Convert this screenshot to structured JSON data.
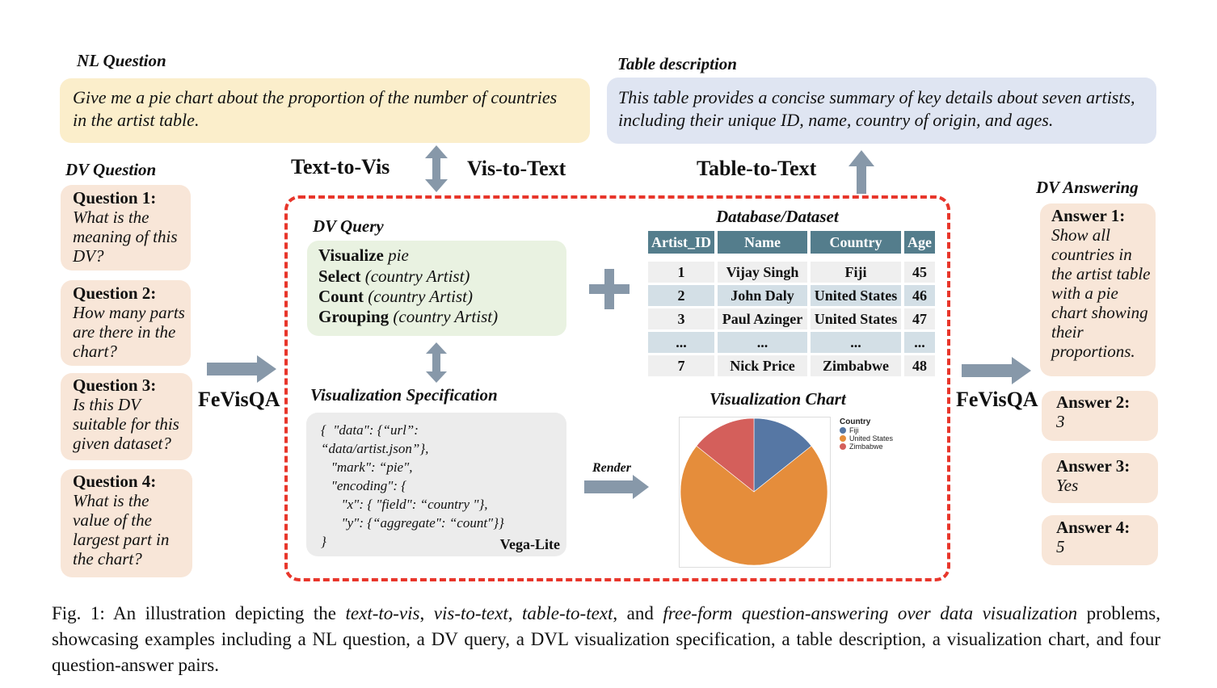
{
  "nl_question": {
    "title": "NL Question",
    "text": "Give me a pie chart about the proportion of the number of countries in the artist table."
  },
  "table_description": {
    "title": "Table description",
    "text": "This table provides a concise summary of key details about seven artists, including their unique ID, name, country of origin, and ages."
  },
  "labels": {
    "text_to_vis": "Text-to-Vis",
    "vis_to_text": "Vis-to-Text",
    "table_to_text": "Table-to-Text",
    "fevisqa_left": "FeVisQA",
    "fevisqa_right": "FeVisQA",
    "render": "Render",
    "vega_lite": "Vega-Lite"
  },
  "dv_question": {
    "title": "DV Question",
    "items": [
      {
        "label": "Question 1:",
        "text": "What is the meaning of this DV?"
      },
      {
        "label": "Question 2:",
        "text": "How many parts are there in the chart?"
      },
      {
        "label": "Question 3:",
        "text": "Is this DV suitable for this given dataset?"
      },
      {
        "label": "Question 4:",
        "text": "What is the value of the largest part in the chart?"
      }
    ]
  },
  "dv_answering": {
    "title": "DV Answering",
    "items": [
      {
        "label": "Answer 1:",
        "text": "Show all countries in the artist table with a pie chart showing their proportions."
      },
      {
        "label": "Answer 2:",
        "text": "3"
      },
      {
        "label": "Answer 3:",
        "text": "Yes"
      },
      {
        "label": "Answer 4:",
        "text": "5"
      }
    ]
  },
  "dv_query": {
    "title": "DV Query",
    "lines": [
      {
        "keyword": "Visualize",
        "arg": "pie"
      },
      {
        "keyword": "Select",
        "arg": "(country Artist)"
      },
      {
        "keyword": "Count",
        "arg": "(country Artist)"
      },
      {
        "keyword": "Grouping",
        "arg": "(country Artist)"
      }
    ]
  },
  "vis_spec": {
    "title": "Visualization Specification",
    "lines": [
      "{  \"data\": {“url”:",
      "“data/artist.json”},",
      "   \"mark\": “pie\",",
      "   \"encoding\": {",
      "      \"x\": { \"field\": “country \"},",
      "      \"y\": {“aggregate\": “count\"}}",
      "}"
    ]
  },
  "database": {
    "title": "Database/Dataset",
    "columns": [
      "Artist_ID",
      "Name",
      "Country",
      "Age"
    ],
    "rows": [
      [
        "1",
        "Vijay Singh",
        "Fiji",
        "45"
      ],
      [
        "2",
        "John Daly",
        "United States",
        "46"
      ],
      [
        "3",
        "Paul Azinger",
        "United States",
        "47"
      ],
      [
        "...",
        "...",
        "...",
        "..."
      ],
      [
        "7",
        "Nick Price",
        "Zimbabwe",
        "48"
      ]
    ]
  },
  "vis_chart": {
    "title": "Visualization Chart"
  },
  "chart_data": {
    "type": "pie",
    "title": "Visualization Chart",
    "legend_title": "Country",
    "legend_position": "top-right",
    "categories": [
      "Fiji",
      "United States",
      "Zimbabwe"
    ],
    "values": [
      1,
      5,
      1
    ],
    "colors": [
      "#5677a4",
      "#e58d3b",
      "#d45f5b"
    ]
  },
  "caption": {
    "prefix": "Fig. 1: An illustration depicting the ",
    "t1": "text-to-vis",
    "s1": ", ",
    "t2": "vis-to-text",
    "s2": ", ",
    "t3": "table-to-text",
    "s3": ", and ",
    "t4": "free-form question-answering over data visualization",
    "suffix": " problems, showcasing examples including a NL question, a DV query, a DVL visualization specification, a table description, a visualization chart, and four question-answer pairs."
  },
  "colors": {
    "arrow": "#8798a9",
    "dashed_border": "#e8362b",
    "table_header": "#547d8c"
  }
}
